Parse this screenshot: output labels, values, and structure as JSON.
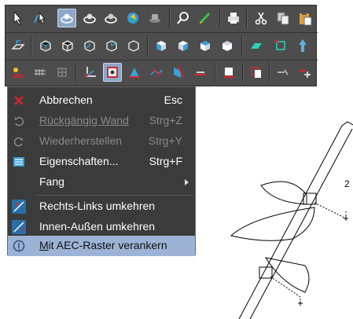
{
  "menu": {
    "items": [
      {
        "label": "Abbrechen",
        "shortcut": "Esc",
        "icon": "cancel-x-icon"
      },
      {
        "label": "Rückgängig Wand",
        "shortcut": "Strg+Z",
        "icon": "undo-icon"
      },
      {
        "label": "Wiederherstellen",
        "shortcut": "Strg+Y",
        "icon": "redo-icon"
      },
      {
        "label": "Eigenschaften...",
        "shortcut": "Strg+F",
        "icon": "properties-icon"
      },
      {
        "label": "Fang",
        "icon": "none"
      },
      {
        "label": "Rechts-Links umkehren",
        "icon": "flip-right-left-icon"
      },
      {
        "label": "Innen-Außen umkehren",
        "icon": "flip-inside-outside-icon"
      },
      {
        "label": "Mit AEC-Raster verankern",
        "icon": "anchor-aec-grid-icon"
      }
    ]
  },
  "drawing": {
    "label": "2"
  },
  "colors": {
    "toolbar_bg": "#4d4d4d",
    "menu_bg": "#3b3b3b",
    "menu_highlight": "#9db3d6",
    "accent_red": "#d7262b",
    "accent_blue": "#3aa0d8"
  }
}
